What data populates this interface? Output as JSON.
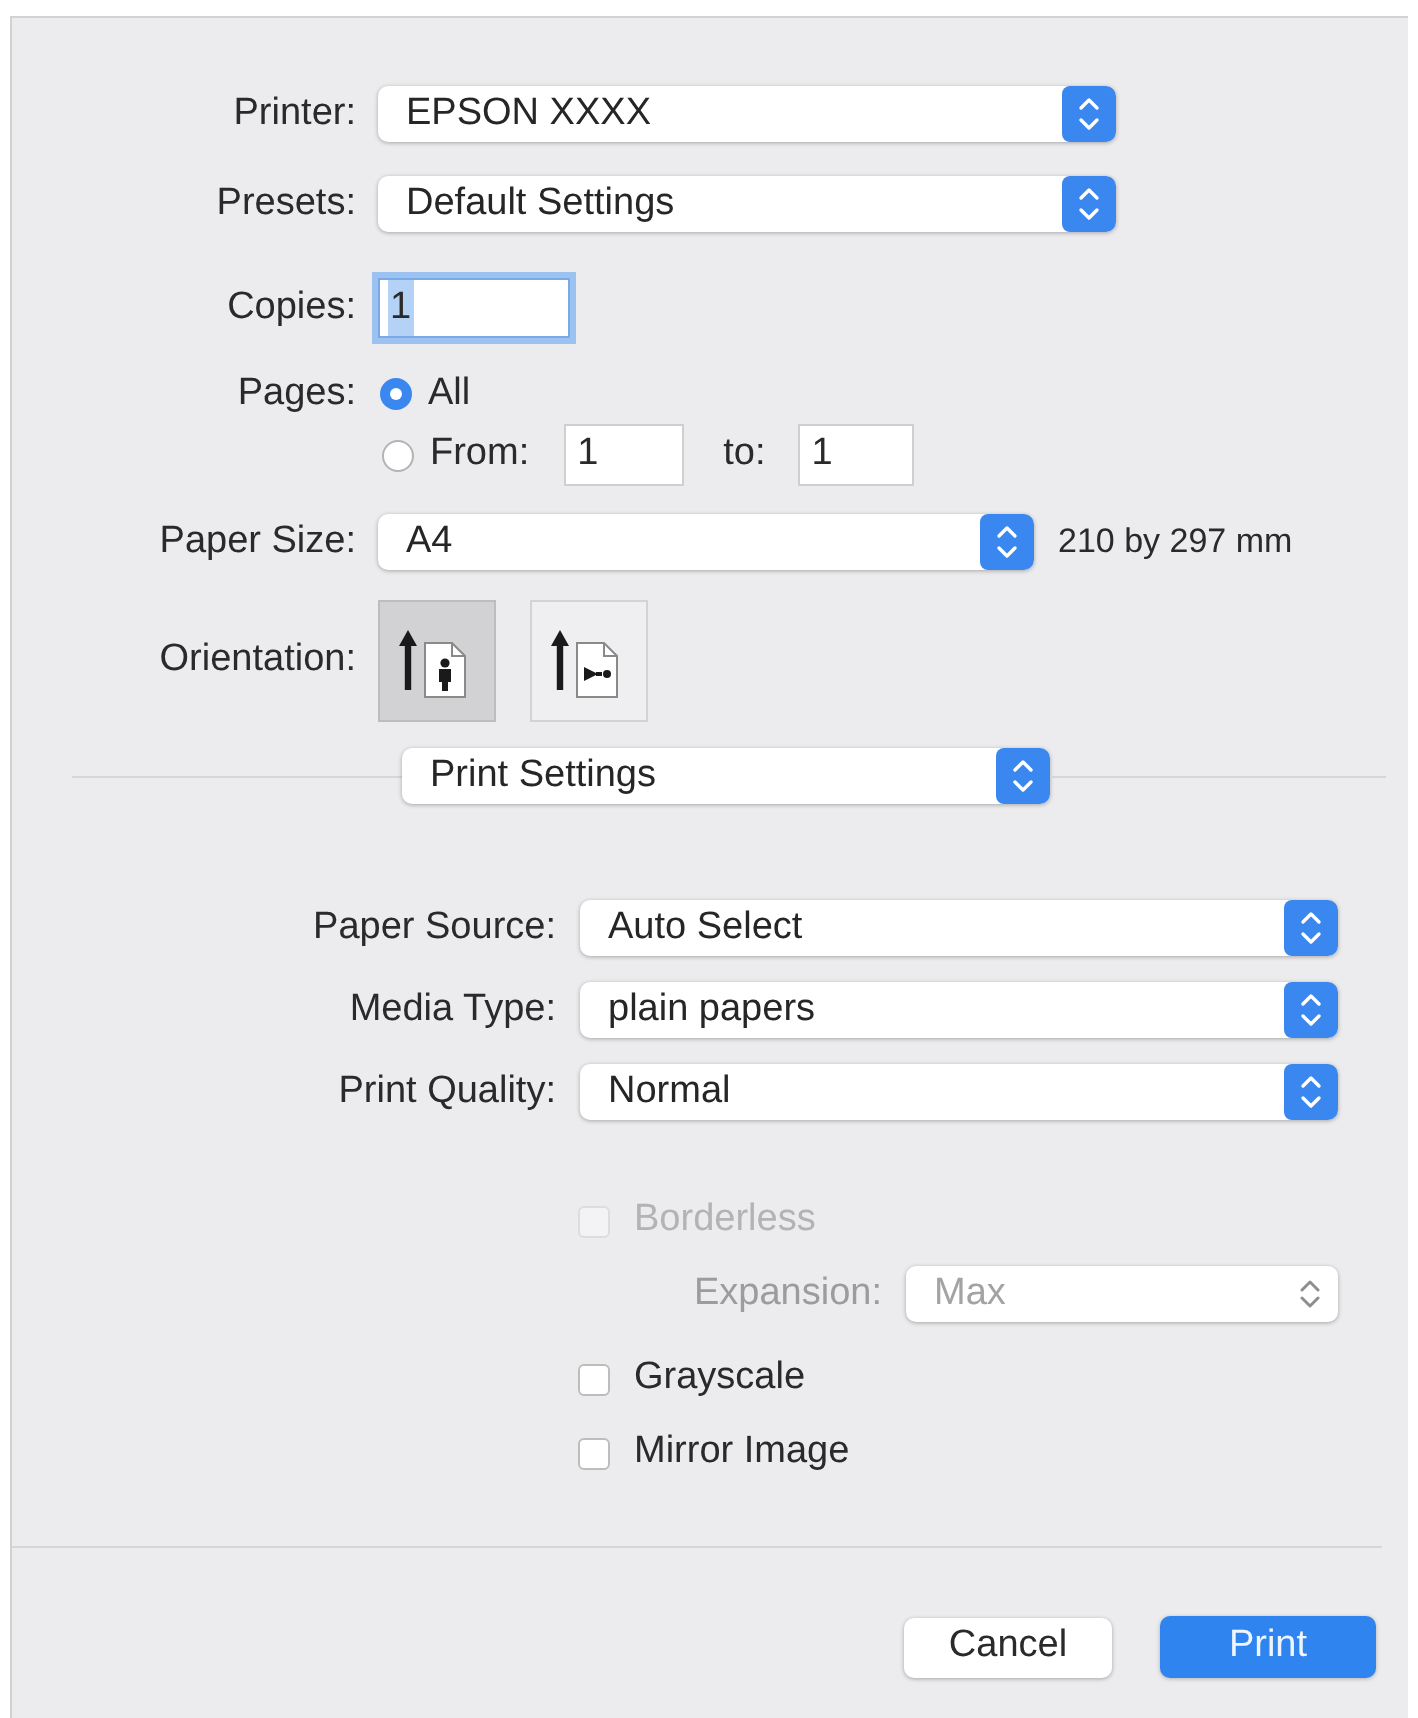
{
  "printer": {
    "label": "Printer:",
    "value": "EPSON XXXX"
  },
  "presets": {
    "label": "Presets:",
    "value": "Default Settings"
  },
  "copies": {
    "label": "Copies:",
    "value": "1",
    "focused": true
  },
  "pages": {
    "label": "Pages:",
    "options": [
      {
        "kind": "all",
        "label": "All",
        "selected": true
      },
      {
        "kind": "range",
        "label": "From:",
        "selected": false,
        "from": "1",
        "to_label": "to:",
        "to": "1"
      }
    ]
  },
  "paper_size": {
    "label": "Paper Size:",
    "value": "A4",
    "dimensions": "210 by 297 mm"
  },
  "orientation": {
    "label": "Orientation:",
    "options": [
      {
        "kind": "portrait",
        "selected": true
      },
      {
        "kind": "landscape",
        "selected": false
      }
    ]
  },
  "panel_menu": {
    "value": "Print Settings"
  },
  "settings": [
    {
      "label": "Paper Source:",
      "value": "Auto Select"
    },
    {
      "label": "Media Type:",
      "value": "plain papers"
    },
    {
      "label": "Print Quality:",
      "value": "Normal"
    }
  ],
  "options": [
    {
      "kind": "checkbox",
      "label": "Borderless",
      "checked": false,
      "disabled": true
    },
    {
      "kind": "select",
      "label": "Expansion:",
      "value": "Max",
      "disabled": true
    },
    {
      "kind": "checkbox",
      "label": "Grayscale",
      "checked": false,
      "disabled": false
    },
    {
      "kind": "checkbox",
      "label": "Mirror Image",
      "checked": false,
      "disabled": false
    }
  ],
  "buttons": [
    {
      "kind": "cancel",
      "label": "Cancel"
    },
    {
      "kind": "default",
      "label": "Print"
    }
  ]
}
